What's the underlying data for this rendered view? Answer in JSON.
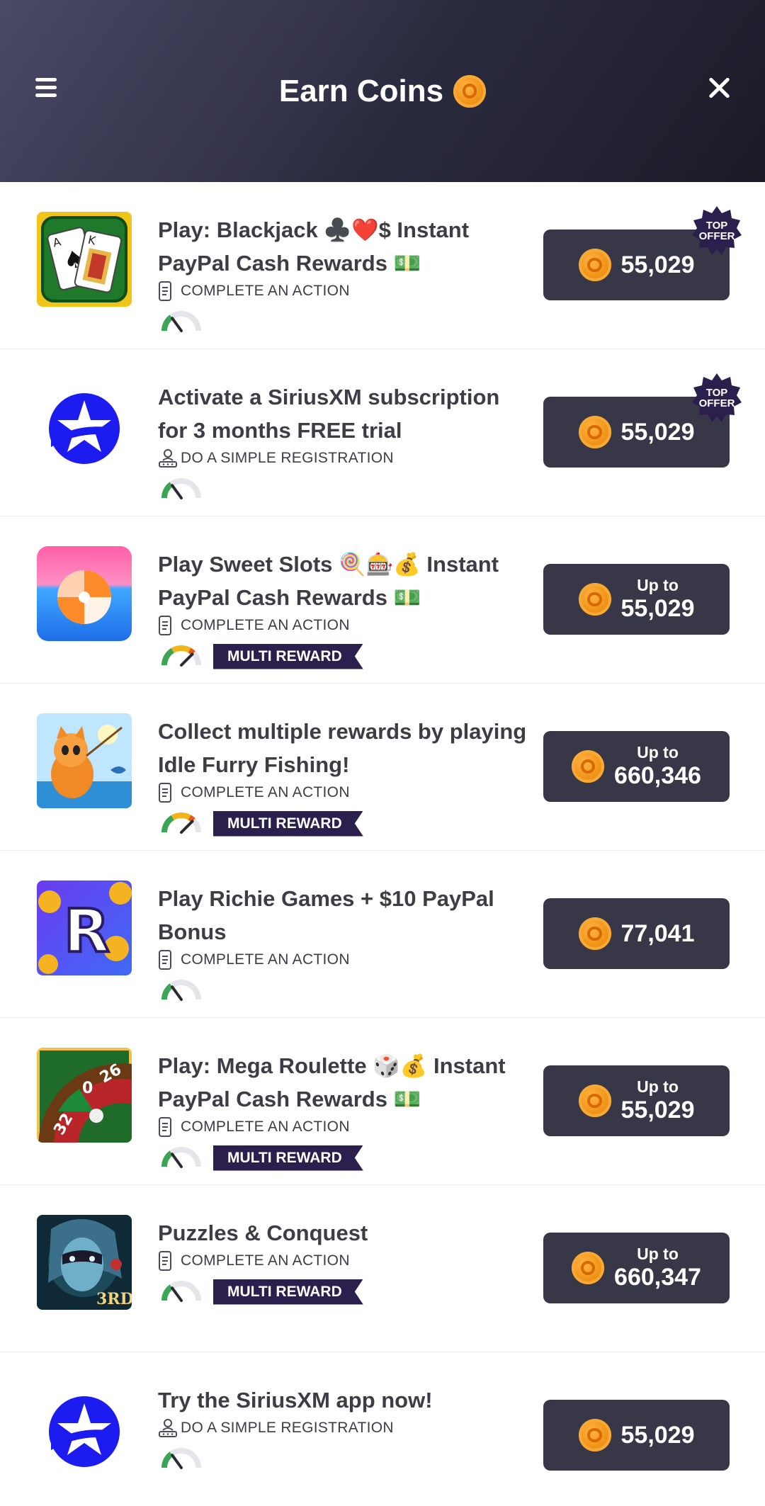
{
  "header": {
    "title": "Earn Coins",
    "menu_icon": "hamburger-menu-icon",
    "close_icon": "close-icon",
    "coin_icon": "coin-icon"
  },
  "colors": {
    "header_gradient_start": "#4a4966",
    "header_gradient_end": "#1b1a27",
    "reward_button": "#383748",
    "coin": "#f39a1e",
    "multi_reward_badge": "#2b1f4e",
    "top_offer_badge": "#2b1f4e"
  },
  "offers": [
    {
      "title_line1": "Play: Blackjack ♣️❤️$ Instant",
      "title_line2": "PayPal Cash Rewards 💵",
      "action": "COMPLETE AN ACTION",
      "action_icon": "phone-icon",
      "amount": "55,029",
      "up_to": "",
      "top_offer": "TOP OFFER",
      "multi_reward": "",
      "difficulty": 0.3,
      "thumbnail": "blackjack-cards"
    },
    {
      "title_line1": "Activate a SiriusXM subscription",
      "title_line2": "for 3 months FREE trial",
      "action": "DO A SIMPLE REGISTRATION",
      "action_icon": "registration-icon",
      "amount": "55,029",
      "up_to": "",
      "top_offer": "TOP OFFER",
      "multi_reward": "",
      "difficulty": 0.3,
      "thumbnail": "siriusxm-logo"
    },
    {
      "title_line1": "Play Sweet Slots 🍭🎰💰 Instant",
      "title_line2": "PayPal Cash Rewards 💵",
      "action": "COMPLETE AN ACTION",
      "action_icon": "phone-icon",
      "amount": "55,029",
      "up_to": "Up to",
      "top_offer": "",
      "multi_reward": "MULTI REWARD",
      "difficulty": 0.75,
      "thumbnail": "sweet-slots-candy"
    },
    {
      "title_line1": "Collect multiple rewards by playing",
      "title_line2": "Idle Furry Fishing!",
      "action": "COMPLETE AN ACTION",
      "action_icon": "phone-icon",
      "amount": "660,346",
      "up_to": "Up to",
      "top_offer": "",
      "multi_reward": "MULTI REWARD",
      "difficulty": 0.75,
      "thumbnail": "idle-furry-fishing-cat"
    },
    {
      "title_line1": "Play Richie Games + $10 PayPal",
      "title_line2": "Bonus",
      "action": "COMPLETE AN ACTION",
      "action_icon": "phone-icon",
      "amount": "77,041",
      "up_to": "",
      "top_offer": "",
      "multi_reward": "",
      "difficulty": 0.3,
      "thumbnail": "richie-games-r"
    },
    {
      "title_line1": "Play: Mega Roulette 🎲💰 Instant",
      "title_line2": "PayPal Cash Rewards 💵",
      "action": "COMPLETE AN ACTION",
      "action_icon": "phone-icon",
      "amount": "55,029",
      "up_to": "Up to",
      "top_offer": "",
      "multi_reward": "MULTI REWARD",
      "difficulty": 0.3,
      "thumbnail": "mega-roulette-wheel"
    },
    {
      "title_line1": "Puzzles & Conquest",
      "title_line2": "",
      "action": "COMPLETE AN ACTION",
      "action_icon": "phone-icon",
      "amount": "660,347",
      "up_to": "Up to",
      "top_offer": "",
      "multi_reward": "MULTI REWARD",
      "difficulty": 0.3,
      "thumbnail": "puzzles-conquest-hero"
    },
    {
      "title_line1": "Try the SiriusXM app now!",
      "title_line2": "",
      "action": "DO A SIMPLE REGISTRATION",
      "action_icon": "registration-icon",
      "amount": "55,029",
      "up_to": "",
      "top_offer": "",
      "multi_reward": "",
      "difficulty": 0.3,
      "thumbnail": "siriusxm-logo"
    }
  ]
}
